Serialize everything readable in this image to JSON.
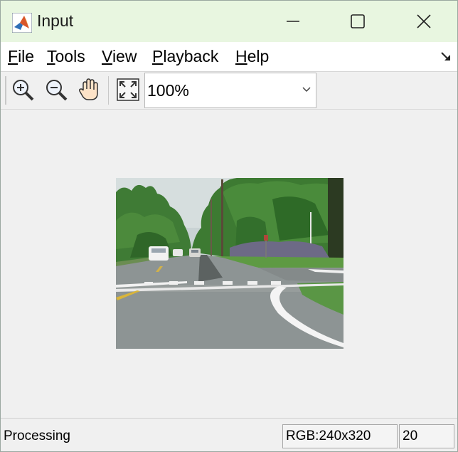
{
  "window": {
    "title": "Input"
  },
  "menu": {
    "file_pre": "",
    "file_key": "F",
    "file_post": "ile",
    "tools_pre": "",
    "tools_key": "T",
    "tools_post": "ools",
    "view_pre": "",
    "view_key": "V",
    "view_post": "iew",
    "playback_pre": "",
    "playback_key": "P",
    "playback_post": "layback",
    "help_pre": "",
    "help_key": "H",
    "help_post": "elp"
  },
  "toolbar": {
    "zoom_value": "100%",
    "icons": [
      "zoom-in-icon",
      "zoom-out-icon",
      "pan-hand-icon",
      "fit-to-view-icon"
    ]
  },
  "status": {
    "state": "Processing",
    "format": "RGB:240x320",
    "frame": "20"
  },
  "colors": {
    "titlebar": "#e8f6e0",
    "window_bg": "#f0f0f0",
    "menubar": "#ffffff"
  }
}
